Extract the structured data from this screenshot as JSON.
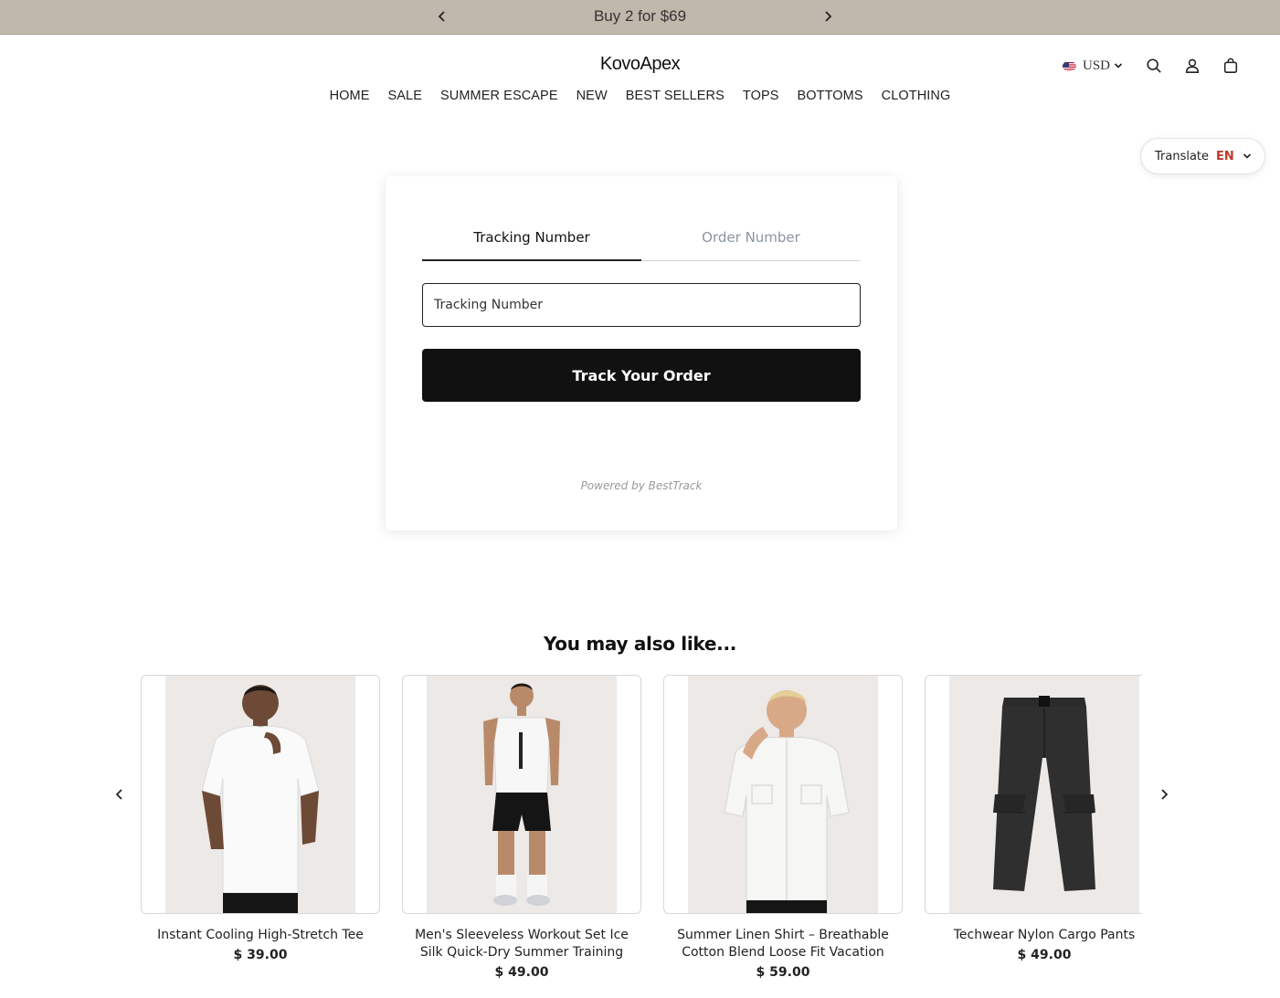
{
  "announcement": {
    "text": "Buy 2 for $69"
  },
  "header": {
    "logo": "KovoApex",
    "currency": "USD",
    "icons": [
      "search-icon",
      "account-icon",
      "cart-icon"
    ]
  },
  "nav": {
    "items": [
      {
        "label": "HOME"
      },
      {
        "label": "SALE"
      },
      {
        "label": "SUMMER ESCAPE"
      },
      {
        "label": "NEW"
      },
      {
        "label": "BEST SELLERS"
      },
      {
        "label": "TOPS"
      },
      {
        "label": "BOTTOMS"
      },
      {
        "label": "CLOTHING"
      }
    ]
  },
  "translate": {
    "label": "Translate",
    "lang": "EN"
  },
  "tracking": {
    "tabs": [
      {
        "label": "Tracking Number",
        "active": true
      },
      {
        "label": "Order Number",
        "active": false
      }
    ],
    "input_placeholder": "Tracking Number",
    "input_value": "",
    "button_label": "Track Your Order",
    "powered_by": "Powered by BestTrack"
  },
  "recommendations": {
    "title": "You may also like...",
    "products": [
      {
        "name": "Instant Cooling High-Stretch Tee",
        "price": "$ 39.00",
        "image": "white t-shirt model"
      },
      {
        "name": "Men's Sleeveless Workout Set Ice Silk Quick-Dry Summer Training",
        "price": "$ 49.00",
        "image": "white tank and black shorts model"
      },
      {
        "name": "Summer Linen Shirt – Breathable Cotton Blend Loose Fit Vacation",
        "price": "$ 59.00",
        "image": "white linen shirt model"
      },
      {
        "name": "Techwear Nylon Cargo Pants",
        "price": "$ 49.00",
        "image": "black cargo pants"
      }
    ]
  },
  "colors": {
    "announcement_bg": "#c0b7ad",
    "button_bg": "#111111",
    "translate_lang": "#c0392b",
    "inactive_tab": "#8a95a0"
  }
}
